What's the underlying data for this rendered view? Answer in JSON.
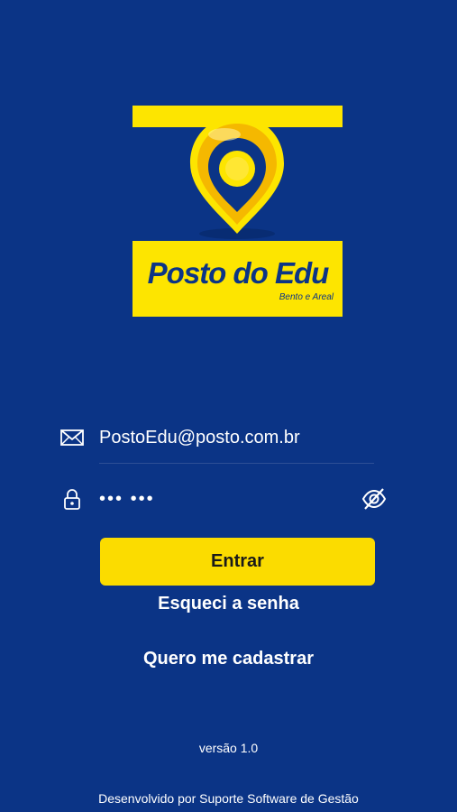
{
  "logo": {
    "brand": "Posto do Edu",
    "tagline": "Bento e Areal"
  },
  "login": {
    "email_icon": "envelope-icon",
    "email_value": "PostoEdu@posto.com.br",
    "password_icon": "lock-icon",
    "password_masked": "••• •••",
    "visibility_icon": "eye-slash-icon",
    "submit_label": "Entrar",
    "forgot_label": "Esqueci a senha",
    "signup_label": "Quero me cadastrar"
  },
  "footer": {
    "version": "versão 1.0",
    "developer": "Desenvolvido por Suporte Software de Gestão"
  },
  "colors": {
    "background": "#0b3486",
    "accent": "#fbdc00",
    "logo_yellow": "#fde500"
  }
}
